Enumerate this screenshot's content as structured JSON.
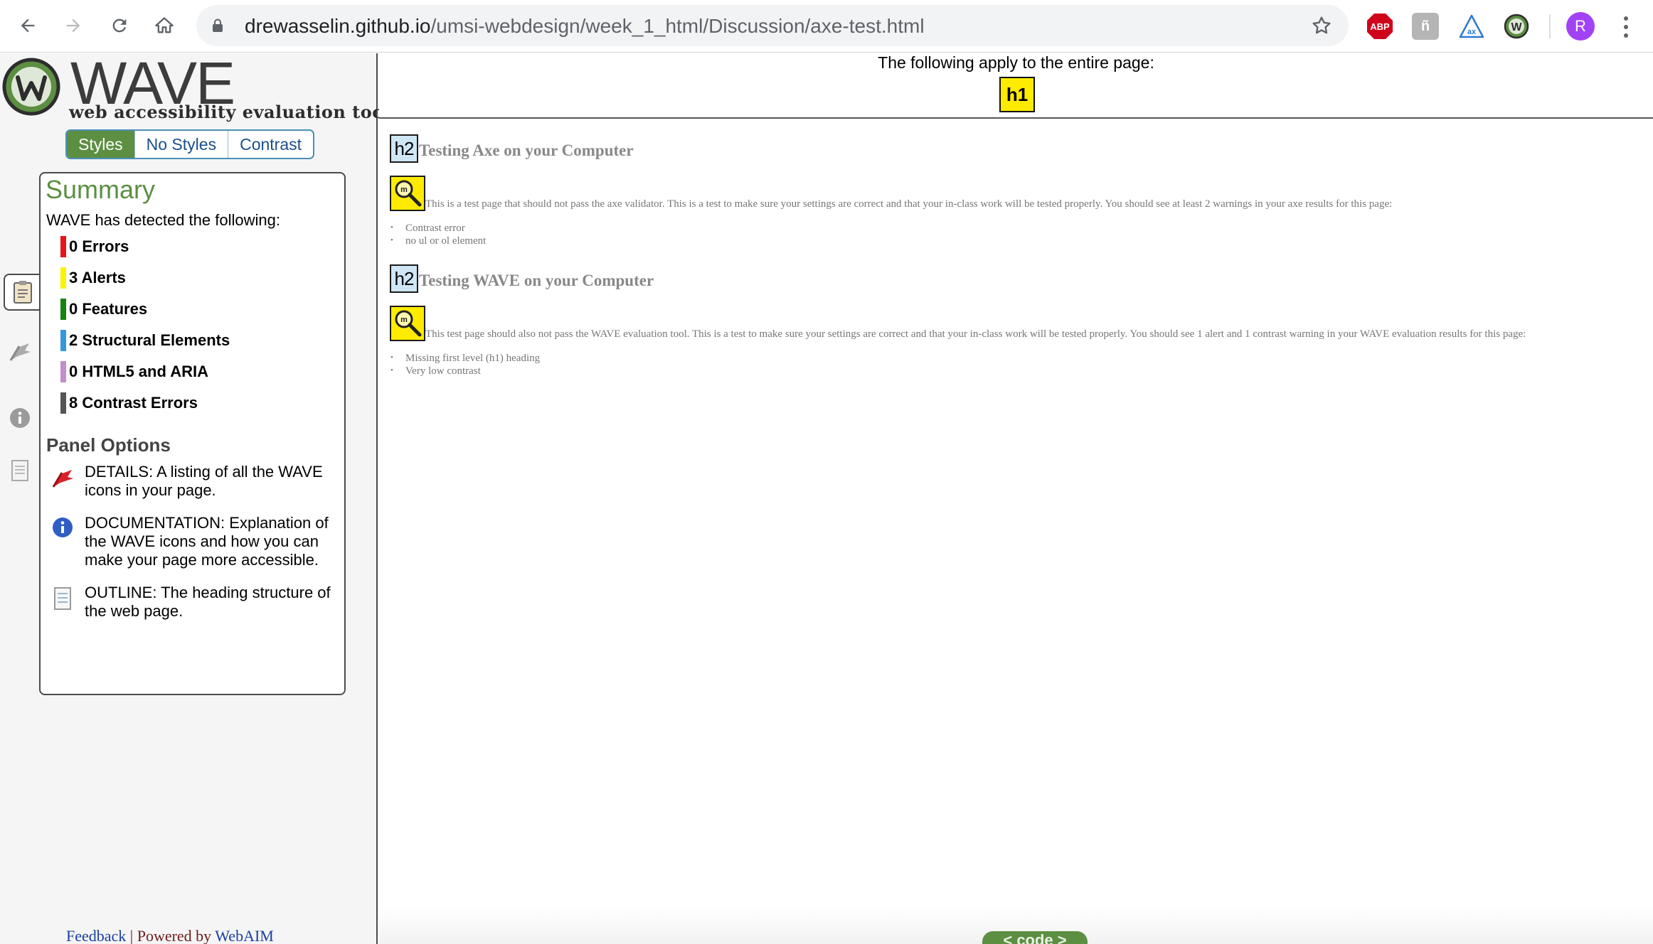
{
  "browser": {
    "url_host": "drewasselin.github.io",
    "url_path": "/umsi-webdesign/week_1_html/Discussion/axe-test.html",
    "extensions": {
      "abp": "ABP",
      "gray": "ñ",
      "wave": "W"
    },
    "profile_initial": "R"
  },
  "wave": {
    "logo_word": "WAVE",
    "logo_sub": "web accessibility evaluation tool",
    "view_tabs": [
      "Styles",
      "No Styles",
      "Contrast"
    ],
    "summary_title": "Summary",
    "detected_text": "WAVE has detected the following:",
    "stats": [
      {
        "label": "0 Errors",
        "color": "#e8131a"
      },
      {
        "label": "3 Alerts",
        "color": "#fff200"
      },
      {
        "label": "0 Features",
        "color": "#15840c"
      },
      {
        "label": "2 Structural Elements",
        "color": "#3498db"
      },
      {
        "label": "0 HTML5 and ARIA",
        "color": "#c28ecb"
      },
      {
        "label": "8 Contrast Errors",
        "color": "#555555"
      }
    ],
    "panel_options_title": "Panel Options",
    "options": [
      {
        "text": "DETAILS: A listing of all the WAVE icons in your page.",
        "icon": "flag-icon"
      },
      {
        "text": "DOCUMENTATION: Explanation of the WAVE icons and how you can make your page more accessible.",
        "icon": "info-icon"
      },
      {
        "text": "OUTLINE: The heading structure of the web page.",
        "icon": "outline-icon"
      }
    ],
    "footer": {
      "feedback": "Feedback",
      "separator": "|",
      "powered": "Powered by",
      "webaim": "WebAIM"
    }
  },
  "page": {
    "apply_text": "The following apply to the entire page:",
    "h1_badge": "h1",
    "h2_badge": "h2",
    "sections": [
      {
        "heading": "Testing Axe on your Computer",
        "paragraph": "This is a test page that should not pass the axe validator. This is a test to make sure your settings are correct and that your in-class work will be tested properly. You should see at least 2 warnings in your axe results for this page:",
        "items": [
          "Contrast error",
          "no ul or ol element"
        ]
      },
      {
        "heading": "Testing WAVE on your Computer",
        "paragraph": "This test page should also not pass the WAVE evaluation tool. This is a test to make sure your settings are correct and that your in-class work will be tested properly. You should see 1 alert and 1 contrast warning in your WAVE evaluation results for this page:",
        "items": [
          "Missing first level (h1) heading",
          "Very low contrast"
        ]
      }
    ],
    "code_toggle": "< code >"
  }
}
